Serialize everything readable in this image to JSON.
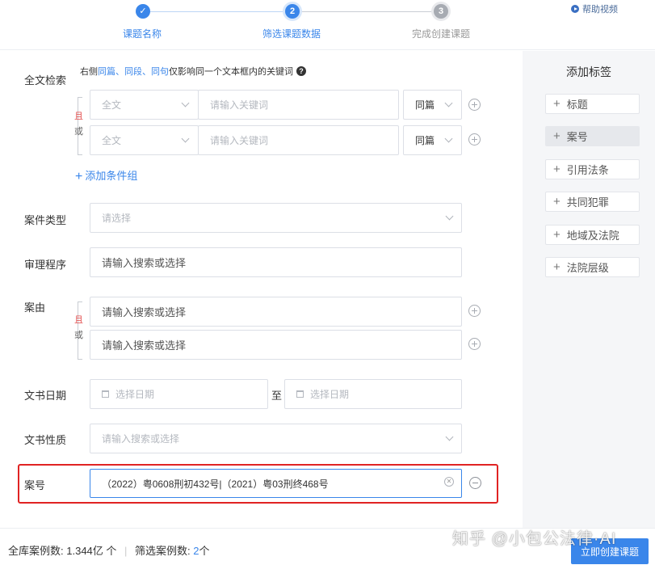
{
  "stepper": {
    "steps": [
      {
        "num": "✓",
        "label": "课题名称"
      },
      {
        "num": "2",
        "label": "筛选课题数据"
      },
      {
        "num": "3",
        "label": "完成创建课题"
      }
    ],
    "help": "帮助视频"
  },
  "fulltext": {
    "label": "全文检索",
    "hint_prefix": "右侧 ",
    "hint_terms": "同篇、同段、同句",
    "hint_suffix": " 仅影响同一个文本框内的关键词",
    "and": "且",
    "or": "或",
    "rows": [
      {
        "scope": "全文",
        "keyword_placeholder": "请输入关键词",
        "match": "同篇"
      },
      {
        "scope": "全文",
        "keyword_placeholder": "请输入关键词",
        "match": "同篇"
      }
    ],
    "add_group": "添加条件组"
  },
  "case_type": {
    "label": "案件类型",
    "placeholder": "请选择"
  },
  "trial_procedure": {
    "label": "审理程序",
    "placeholder": "请输入搜索或选择"
  },
  "cause": {
    "label": "案由",
    "and": "且",
    "or": "或",
    "rows": [
      {
        "placeholder": "请输入搜索或选择"
      },
      {
        "placeholder": "请输入搜索或选择"
      }
    ]
  },
  "doc_date": {
    "label": "文书日期",
    "start_placeholder": "选择日期",
    "to": "至",
    "end_placeholder": "选择日期"
  },
  "doc_nature": {
    "label": "文书性质",
    "placeholder": "请输入搜索或选择"
  },
  "case_number": {
    "label": "案号",
    "value": "（2022）粤0608刑初432号|（2021）粤03刑终468号"
  },
  "right_panel": {
    "title": "添加标签",
    "tags": [
      "标题",
      "案号",
      "引用法条",
      "共同犯罪",
      "地域及法院",
      "法院层级"
    ]
  },
  "footer": {
    "total_label": "全库案例数:",
    "total_value": "1.344亿 个",
    "filtered_label": "筛选案例数:",
    "filtered_value": "2",
    "filtered_unit": "个",
    "create_button": "立即创建课题"
  },
  "watermark": "知乎 @小包公法律·AI",
  "colors": {
    "accent": "#3a86ea",
    "highlight": "#e02323",
    "and": "#e24a4a"
  }
}
